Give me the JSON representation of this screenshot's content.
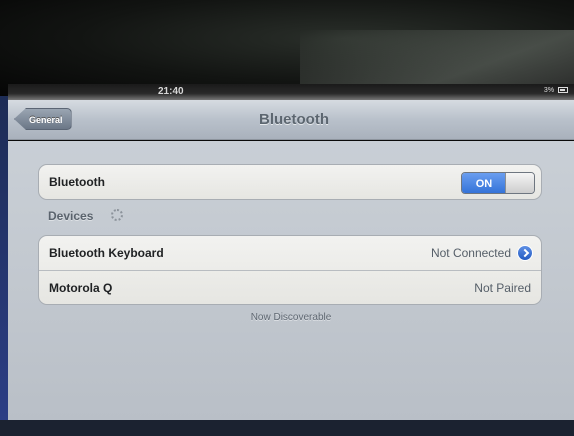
{
  "status_bar": {
    "time": "21:40",
    "right_text": "3%"
  },
  "nav": {
    "back_label": "General",
    "title": "Bluetooth"
  },
  "bluetooth_row": {
    "label": "Bluetooth",
    "toggle_label": "ON",
    "toggle_state": "on"
  },
  "devices_header": "Devices",
  "devices": [
    {
      "name": "Bluetooth Keyboard",
      "status": "Not Connected",
      "icon": "disclosure-icon"
    },
    {
      "name": "Motorola Q",
      "status": "Not Paired"
    }
  ],
  "footer_note": "Now Discoverable",
  "colors": {
    "accent": "#2f6fd6",
    "nav_bar": "#b9c1cb",
    "background": "#c5cbd2"
  }
}
